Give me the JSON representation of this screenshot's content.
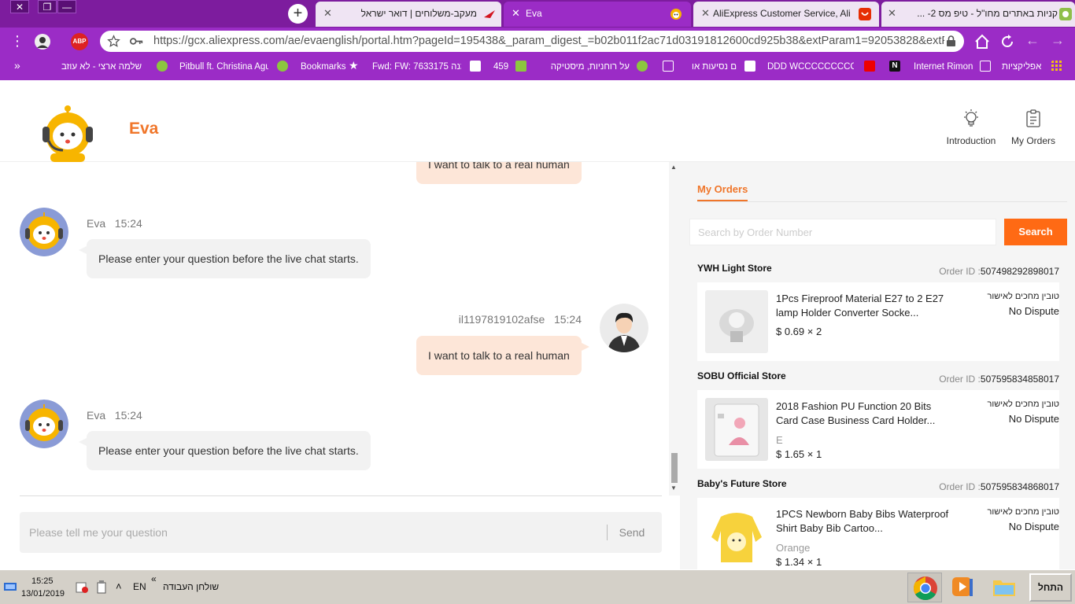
{
  "browser": {
    "window_buttons": [
      "✕",
      "❐",
      "—"
    ],
    "new_tab": "+",
    "tabs": [
      {
        "title": "מעקב-משלוחים | דואר ישראל",
        "close": "✕"
      },
      {
        "title": "Eva",
        "close": "✕"
      },
      {
        "title": "AliExpress Customer Service, AliExpress",
        "close": "✕"
      },
      {
        "title": "קניות באתרים מחו\"ל - טיפ מס 2- ...",
        "close": "✕"
      }
    ],
    "url": "https://gcx.aliexpress.com/ae/evaenglish/portal.htm?pageId=195438&_param_digest_=b02b011f2ac71d03191812600cd925b38&extParam1=92053828&extParam...",
    "abp_label": "ABP",
    "bookmarks_overflow": "»",
    "bookmarks": [
      "שלמה ארצי - לא עוזב",
      "Pitbull ft. Christina Aguil",
      "Bookmarks",
      "Fwd: FW: 7633175 הזמנה",
      "459",
      "על רוחניות, מיסטיקה",
      "ם נסיעות או",
      "DDD WCCCCCCCCCCCC",
      "Internet Rimon",
      "אפליקציות"
    ]
  },
  "header": {
    "brand": "Eva",
    "links": [
      {
        "label": "Introduction",
        "icon": "lightbulb-icon"
      },
      {
        "label": "My Orders",
        "icon": "clipboard-icon"
      }
    ]
  },
  "chat": {
    "messages": [
      {
        "from": "user",
        "sender": "",
        "time": "",
        "text": "I want to talk to a real human"
      },
      {
        "from": "bot",
        "sender": "Eva",
        "time": "15:24",
        "text": "Please enter your question before the live chat starts."
      },
      {
        "from": "user",
        "sender": "il1197819102afse",
        "time": "15:24",
        "text": "I want to talk to a real human"
      },
      {
        "from": "bot",
        "sender": "Eva",
        "time": "15:24",
        "text": "Please enter your question before the live chat starts."
      }
    ],
    "input_placeholder": "Please tell me your question",
    "send_label": "Send"
  },
  "orders": {
    "title": "My Orders",
    "search_placeholder": "Search by Order Number",
    "search_label": "Search",
    "order_id_label": "Order ID :",
    "items": [
      {
        "store": "YWH Light Store",
        "order_id": "507498292898017",
        "name": "1Pcs Fireproof Material E27 to 2 E27 lamp Holder Converter Socke...",
        "sku": "",
        "price": "$ 0.69 × 2",
        "status": "טובין מחכים לאישור",
        "dispute": "No Dispute"
      },
      {
        "store": "SOBU Official Store",
        "order_id": "507595834858017",
        "name": "2018 Fashion PU Function 20 Bits Card Case Business Card Holder...",
        "sku": "E",
        "price": "$ 1.65 × 1",
        "status": "טובין מחכים לאישור",
        "dispute": "No Dispute"
      },
      {
        "store": "Baby's Future Store",
        "order_id": "507595834868017",
        "name": "1PCS Newborn Baby Bibs Waterproof Shirt Baby Bib Cartoo...",
        "sku": "Orange",
        "price": "$ 1.34 × 1",
        "status": "טובין מחכים לאישור",
        "dispute": "No Dispute"
      }
    ]
  },
  "taskbar": {
    "time": "15:25",
    "date": "13/01/2019",
    "lang": "EN",
    "desktop_label": "שולחן העבודה",
    "desktop_chevron": "«",
    "tray_arrow": "˄",
    "start_label": "התחל"
  },
  "colors": {
    "accent": "#f0762a",
    "search_button": "#ff6a14",
    "browser_frame": "#9b2cc6"
  }
}
